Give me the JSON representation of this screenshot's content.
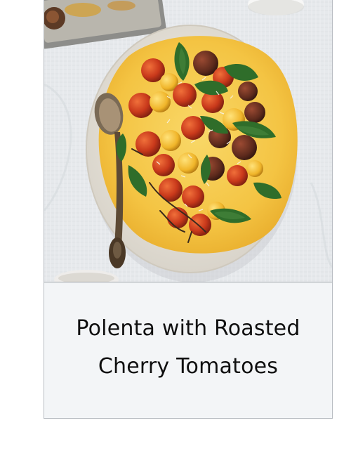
{
  "recipe": {
    "title": "Polenta with Roasted Cherry Tomatoes",
    "image_icon": "photo-icon"
  },
  "colors": {
    "tablecloth": "#e8ebee",
    "plate": "#eeeae2",
    "polenta": "#f6c545",
    "tomato_red": "#c23a1c",
    "tomato_yellow": "#f0b92b",
    "basil": "#2f6d2a",
    "caption_bg": "#f3f5f7",
    "title_text": "#0f0f0f"
  }
}
